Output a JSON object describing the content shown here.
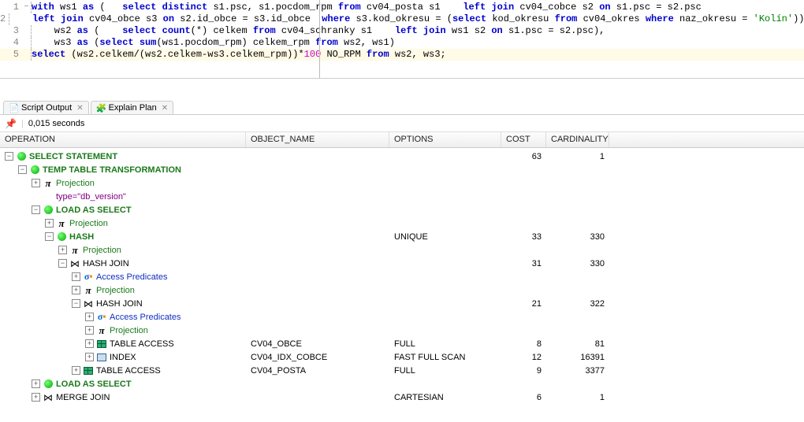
{
  "sql": {
    "lines": [
      {
        "n": "1",
        "fold": "−",
        "hl": false,
        "tokens": [
          {
            "t": "with",
            "c": "kw"
          },
          {
            "t": " ws1 "
          },
          {
            "t": "as",
            "c": "kw"
          },
          {
            "t": " (   "
          },
          {
            "t": "select distinct",
            "c": "kw"
          },
          {
            "t": " s1.psc, s1.pocdom_rpm "
          },
          {
            "t": "from",
            "c": "kw"
          },
          {
            "t": " cv04_posta s1    "
          },
          {
            "t": "left join",
            "c": "kw"
          },
          {
            "t": " cv04_cobce s2 "
          },
          {
            "t": "on",
            "c": "kw"
          },
          {
            "t": " s1.psc = s2.psc"
          }
        ]
      },
      {
        "n": "2",
        "fold": "",
        "hl": false,
        "tokens": [
          {
            "t": "    "
          },
          {
            "t": "left join",
            "c": "kw"
          },
          {
            "t": " cv04_obce s3 "
          },
          {
            "t": "on",
            "c": "kw"
          },
          {
            "t": " s2.id_obce = s3.id_obce  "
          },
          {
            "t": "where",
            "c": "kw"
          },
          {
            "t": " s3.kod_okresu = ("
          },
          {
            "t": "select",
            "c": "kw"
          },
          {
            "t": " kod_okresu "
          },
          {
            "t": "from",
            "c": "kw"
          },
          {
            "t": " cv04_okres "
          },
          {
            "t": "where",
            "c": "kw"
          },
          {
            "t": " naz_okresu = "
          },
          {
            "t": "'Kolín'",
            "c": "str"
          },
          {
            "t": ")),"
          }
        ]
      },
      {
        "n": "3",
        "fold": "",
        "hl": false,
        "tokens": [
          {
            "t": "    ws2 "
          },
          {
            "t": "as",
            "c": "kw"
          },
          {
            "t": " (    "
          },
          {
            "t": "select count",
            "c": "kw"
          },
          {
            "t": "(*) celkem "
          },
          {
            "t": "from",
            "c": "kw"
          },
          {
            "t": " cv04_schranky s1    "
          },
          {
            "t": "left join",
            "c": "kw"
          },
          {
            "t": " ws1 s2 "
          },
          {
            "t": "on",
            "c": "kw"
          },
          {
            "t": " s1.psc = s2.psc),"
          }
        ]
      },
      {
        "n": "4",
        "fold": "",
        "hl": false,
        "tokens": [
          {
            "t": "    ws3 "
          },
          {
            "t": "as",
            "c": "kw"
          },
          {
            "t": " ("
          },
          {
            "t": "select sum",
            "c": "kw"
          },
          {
            "t": "(ws1.pocdom_rpm) celkem_rpm "
          },
          {
            "t": "from",
            "c": "kw"
          },
          {
            "t": " ws2, ws1)"
          }
        ]
      },
      {
        "n": "5",
        "fold": "",
        "hl": true,
        "tokens": [
          {
            "t": "select",
            "c": "kw"
          },
          {
            "t": " (ws2.celkem/(ws2.celkem-ws3.celkem_rpm))*"
          },
          {
            "t": "100",
            "c": "num"
          },
          {
            "t": " NO_RPM "
          },
          {
            "t": "from",
            "c": "kw"
          },
          {
            "t": " ws2, ws3;"
          }
        ]
      }
    ]
  },
  "tabs": [
    {
      "label": "Script Output",
      "icon": "script"
    },
    {
      "label": "Explain Plan",
      "icon": "plan"
    }
  ],
  "toolbar": {
    "seconds": "0,015 seconds"
  },
  "headers": {
    "op": "OPERATION",
    "obj": "OBJECT_NAME",
    "opt": "OPTIONS",
    "cost": "COST",
    "card": "CARDINALITY"
  },
  "plan": [
    {
      "d": 0,
      "tg": "-",
      "ic": "dot",
      "lbl": "SELECT STATEMENT",
      "cls": "lbl-green-b",
      "obj": "",
      "opt": "",
      "cost": "63",
      "card": "1"
    },
    {
      "d": 1,
      "tg": "-",
      "ic": "dot",
      "lbl": "TEMP TABLE TRANSFORMATION",
      "cls": "lbl-green-b",
      "obj": "",
      "opt": "",
      "cost": "",
      "card": ""
    },
    {
      "d": 2,
      "tg": "+",
      "ic": "pi",
      "lbl": "Projection",
      "cls": "lbl-green",
      "obj": "",
      "opt": "",
      "cost": "",
      "card": ""
    },
    {
      "d": 2,
      "tg": "",
      "ic": "",
      "lbl": "type=\"db_version\"",
      "cls": "lbl-purple",
      "obj": "",
      "opt": "",
      "cost": "",
      "card": ""
    },
    {
      "d": 2,
      "tg": "-",
      "ic": "dot",
      "lbl": "LOAD AS SELECT",
      "cls": "lbl-green-b",
      "obj": "",
      "opt": "",
      "cost": "",
      "card": ""
    },
    {
      "d": 3,
      "tg": "+",
      "ic": "pi",
      "lbl": "Projection",
      "cls": "lbl-green",
      "obj": "",
      "opt": "",
      "cost": "",
      "card": ""
    },
    {
      "d": 3,
      "tg": "-",
      "ic": "dot",
      "lbl": "HASH",
      "cls": "lbl-green-b",
      "obj": "",
      "opt": "UNIQUE",
      "cost": "33",
      "card": "330"
    },
    {
      "d": 4,
      "tg": "+",
      "ic": "pi",
      "lbl": "Projection",
      "cls": "lbl-green",
      "obj": "",
      "opt": "",
      "cost": "",
      "card": ""
    },
    {
      "d": 4,
      "tg": "-",
      "ic": "bow",
      "lbl": "HASH JOIN",
      "cls": "lbl-black",
      "obj": "",
      "opt": "",
      "cost": "31",
      "card": "330"
    },
    {
      "d": 5,
      "tg": "+",
      "ic": "sig",
      "lbl": "Access Predicates",
      "cls": "lbl-blue",
      "obj": "",
      "opt": "",
      "cost": "",
      "card": ""
    },
    {
      "d": 5,
      "tg": "+",
      "ic": "pi",
      "lbl": "Projection",
      "cls": "lbl-green",
      "obj": "",
      "opt": "",
      "cost": "",
      "card": ""
    },
    {
      "d": 5,
      "tg": "-",
      "ic": "bow",
      "lbl": "HASH JOIN",
      "cls": "lbl-black",
      "obj": "",
      "opt": "",
      "cost": "21",
      "card": "322"
    },
    {
      "d": 6,
      "tg": "+",
      "ic": "sig",
      "lbl": "Access Predicates",
      "cls": "lbl-blue",
      "obj": "",
      "opt": "",
      "cost": "",
      "card": ""
    },
    {
      "d": 6,
      "tg": "+",
      "ic": "pi",
      "lbl": "Projection",
      "cls": "lbl-green",
      "obj": "",
      "opt": "",
      "cost": "",
      "card": ""
    },
    {
      "d": 6,
      "tg": "+",
      "ic": "tbl",
      "lbl": "TABLE ACCESS",
      "cls": "lbl-black",
      "obj": "CV04_OBCE",
      "opt": "FULL",
      "cost": "8",
      "card": "81"
    },
    {
      "d": 6,
      "tg": "+",
      "ic": "idx",
      "lbl": "INDEX",
      "cls": "lbl-black",
      "obj": "CV04_IDX_COBCE",
      "opt": "FAST FULL SCAN",
      "cost": "12",
      "card": "16391"
    },
    {
      "d": 5,
      "tg": "+",
      "ic": "tbl",
      "lbl": "TABLE ACCESS",
      "cls": "lbl-black",
      "obj": "CV04_POSTA",
      "opt": "FULL",
      "cost": "9",
      "card": "3377"
    },
    {
      "d": 2,
      "tg": "+",
      "ic": "dot",
      "lbl": "LOAD AS SELECT",
      "cls": "lbl-green-b",
      "obj": "",
      "opt": "",
      "cost": "",
      "card": ""
    },
    {
      "d": 2,
      "tg": "+",
      "ic": "bow",
      "lbl": "MERGE JOIN",
      "cls": "lbl-black",
      "obj": "",
      "opt": "CARTESIAN",
      "cost": "6",
      "card": "1"
    }
  ]
}
